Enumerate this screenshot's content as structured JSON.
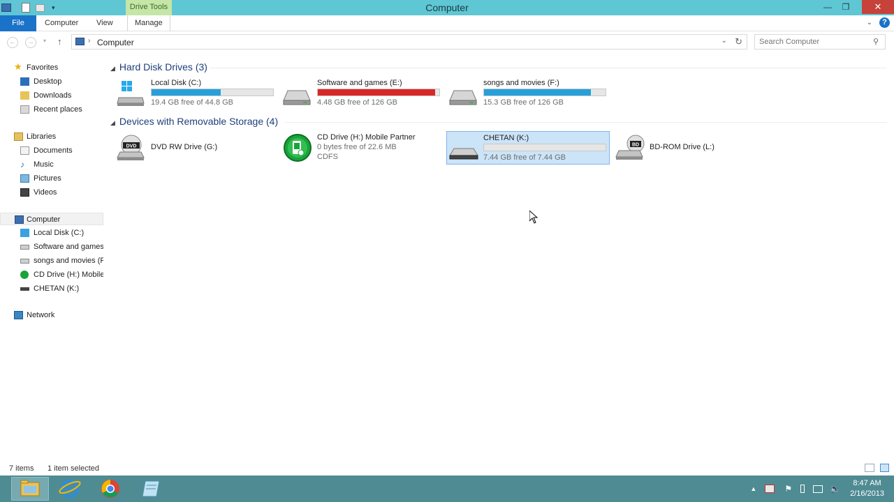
{
  "window": {
    "title": "Computer",
    "context_tab": "Drive Tools"
  },
  "ribbon": {
    "tabs": [
      "File",
      "Computer",
      "View",
      "Manage"
    ]
  },
  "address": {
    "path": "Computer",
    "search_placeholder": "Search Computer"
  },
  "sidebar": {
    "favorites": "Favorites",
    "fav_items": [
      "Desktop",
      "Downloads",
      "Recent places"
    ],
    "libraries": "Libraries",
    "lib_items": [
      "Documents",
      "Music",
      "Pictures",
      "Videos"
    ],
    "computer": "Computer",
    "comp_items": [
      "Local Disk (C:)",
      "Software and games",
      "songs and movies (F",
      "CD Drive (H:) Mobile",
      "CHETAN (K:)"
    ],
    "network": "Network"
  },
  "groups": {
    "hdd": "Hard Disk Drives (3)",
    "removable": "Devices with Removable Storage (4)"
  },
  "drives": {
    "c": {
      "name": "Local Disk (C:)",
      "free": "19.4 GB free of 44.8 GB",
      "used_fraction": 0.567
    },
    "e": {
      "name": "Software and games (E:)",
      "free": "4.48 GB free of 126 GB",
      "used_fraction": 0.964
    },
    "f": {
      "name": "songs and movies (F:)",
      "free": "15.3 GB free of 126 GB",
      "used_fraction": 0.879
    },
    "g": {
      "name": "DVD RW Drive (G:)"
    },
    "h": {
      "name": "CD Drive (H:) Mobile Partner",
      "free": "0 bytes free of 22.6 MB",
      "fs": "CDFS"
    },
    "k": {
      "name": "CHETAN (K:)",
      "free": "7.44 GB free of 7.44 GB",
      "used_fraction": 0.0
    },
    "l": {
      "name": "BD-ROM Drive (L:)"
    }
  },
  "status": {
    "items": "7 items",
    "selected": "1 item selected"
  },
  "clock": {
    "time": "8:47 AM",
    "date": "2/16/2013"
  },
  "colors": {
    "titlebar": "#5fc6d4",
    "file_tab": "#1a73c8",
    "bar_normal": "#26a0da",
    "bar_full": "#da2626",
    "taskbar": "#4f8b93"
  }
}
